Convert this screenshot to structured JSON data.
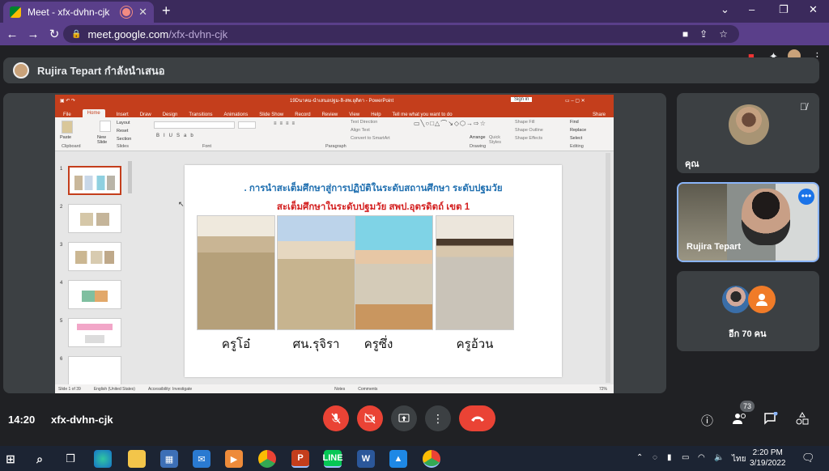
{
  "browser": {
    "tab_title": "Meet - xfx-dvhn-cjk",
    "new_tab": "+",
    "url_host": "meet.google.com",
    "url_path": "/xfx-dvhn-cjk",
    "minimize": "⌄",
    "win_min": "–",
    "win_max": "❐",
    "win_close": "✕"
  },
  "meet": {
    "presenter_text": "Rujira Tepart กำลังนำเสนอ",
    "time": "14:20",
    "meeting_code": "xfx-dvhn-cjk",
    "participants_count": "73",
    "tiles": {
      "you_label": "คุณ",
      "rujira_label": "Rujira Tepart",
      "others_label": "อีก 70 คน"
    }
  },
  "powerpoint": {
    "title": "19Dนาคม-นำเสนอปฐม-ลิ-สพ.อุดิตา - PowerPoint",
    "sign_in": "Sign in",
    "tabs": [
      "File",
      "Home",
      "Insert",
      "Draw",
      "Design",
      "Transitions",
      "Animations",
      "Slide Show",
      "Record",
      "Review",
      "View",
      "Help",
      "Tell me what you want to do"
    ],
    "share": "Share",
    "groups": [
      "Clipboard",
      "Slides",
      "Font",
      "Paragraph",
      "Drawing",
      "Editing"
    ],
    "ribbon_items": {
      "paste": "Paste",
      "new_slide": "New Slide",
      "layout": "Layout",
      "reset": "Reset",
      "section": "Section",
      "text_direction": "Text Direction",
      "align_text": "Align Text",
      "convert_smartart": "Convert to SmartArt",
      "arrange": "Arrange",
      "quick_styles": "Quick Styles",
      "shape_fill": "Shape Fill",
      "shape_outline": "Shape Outline",
      "shape_effects": "Shape Effects",
      "find": "Find",
      "replace": "Replace",
      "select": "Select"
    },
    "slide_numbers": [
      "1",
      "2",
      "3",
      "4",
      "5",
      "6"
    ],
    "slide": {
      "line1": ". การนำสะเต็มศึกษาสู่การปฏิบัติในระดับสถานศึกษา ระดับปฐมวัย",
      "line2": "สะเต็มศึกษาในระดับปฐมวัย  สพป.อุตรดิตถ์ เขต 1",
      "names": [
        "ครูโอ๋",
        "ศน.รุจิรา",
        "ครูซึ่ง",
        "ครูอ้วน"
      ]
    },
    "status": {
      "slide_of": "Slide 1 of 39",
      "language": "English (United States)",
      "accessibility": "Accessibility: Investigate",
      "notes": "Notes",
      "comments": "Comments",
      "zoom": "72%"
    }
  },
  "taskbar": {
    "time": "2:20 PM",
    "date": "3/19/2022",
    "lang": "ไทย"
  },
  "colors": {
    "ppt_red": "#c43e1c",
    "meet_red": "#ea4335",
    "chrome_purple": "#5a3f8a"
  }
}
